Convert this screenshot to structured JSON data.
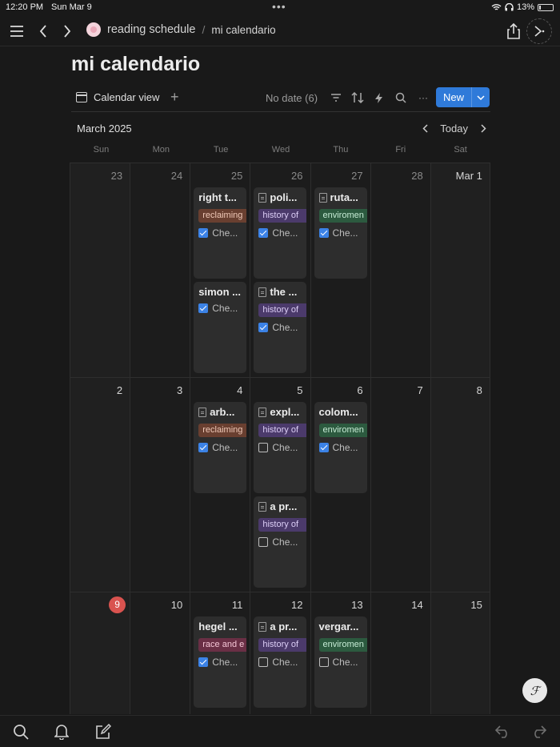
{
  "status": {
    "time": "12:20 PM",
    "date": "Sun Mar 9",
    "battery": "13%"
  },
  "nav": {
    "breadcrumb_parent": "reading schedule",
    "breadcrumb_sep": "/",
    "breadcrumb_current": "mi calendario"
  },
  "page": {
    "title": "mi calendario"
  },
  "toolbar": {
    "view_label": "Calendar view",
    "add_symbol": "+",
    "no_date": "No date (6)",
    "more_symbol": "···",
    "new_label": "New"
  },
  "calendar": {
    "month": "March 2025",
    "today_label": "Today",
    "weekdays": [
      "Sun",
      "Mon",
      "Tue",
      "Wed",
      "Thu",
      "Fri",
      "Sat"
    ],
    "weeks": [
      {
        "days": [
          "23",
          "24",
          "25",
          "26",
          "27",
          "28",
          "Mar 1"
        ]
      },
      {
        "days": [
          "2",
          "3",
          "4",
          "5",
          "6",
          "7",
          "8"
        ]
      },
      {
        "days": [
          "9",
          "10",
          "11",
          "12",
          "13",
          "14",
          "15"
        ]
      }
    ],
    "events": {
      "w0_tue_a": {
        "title": "right t...",
        "tag": "reclaiming",
        "check": "Che..."
      },
      "w0_tue_b": {
        "title": "simon ...",
        "check": "Che..."
      },
      "w0_wed_a": {
        "title": "poli...",
        "tag": "history of",
        "check": "Che..."
      },
      "w0_wed_b": {
        "title": "the ...",
        "tag": "history of",
        "check": "Che..."
      },
      "w0_thu_a": {
        "title": "ruta...",
        "tag": "enviromen",
        "check": "Che..."
      },
      "w1_tue_a": {
        "title": "arb...",
        "tag": "reclaiming",
        "check": "Che..."
      },
      "w1_wed_a": {
        "title": "expl...",
        "tag": "history of",
        "check": "Che..."
      },
      "w1_wed_b": {
        "title": "a pr...",
        "tag": "history of",
        "check": "Che..."
      },
      "w1_thu_a": {
        "title": "colom...",
        "tag": "enviromen",
        "check": "Che..."
      },
      "w2_tue_a": {
        "title": "hegel ...",
        "tag": "race and e",
        "check": "Che..."
      },
      "w2_wed_a": {
        "title": "a pr...",
        "tag": "history of",
        "check": "Che..."
      },
      "w2_thu_a": {
        "title": "vergar...",
        "tag": "enviromen",
        "check": "Che..."
      }
    }
  },
  "colors": {
    "accent": "#2f7ad9",
    "today": "#d9534f",
    "checkbox": "#3b82e6"
  }
}
